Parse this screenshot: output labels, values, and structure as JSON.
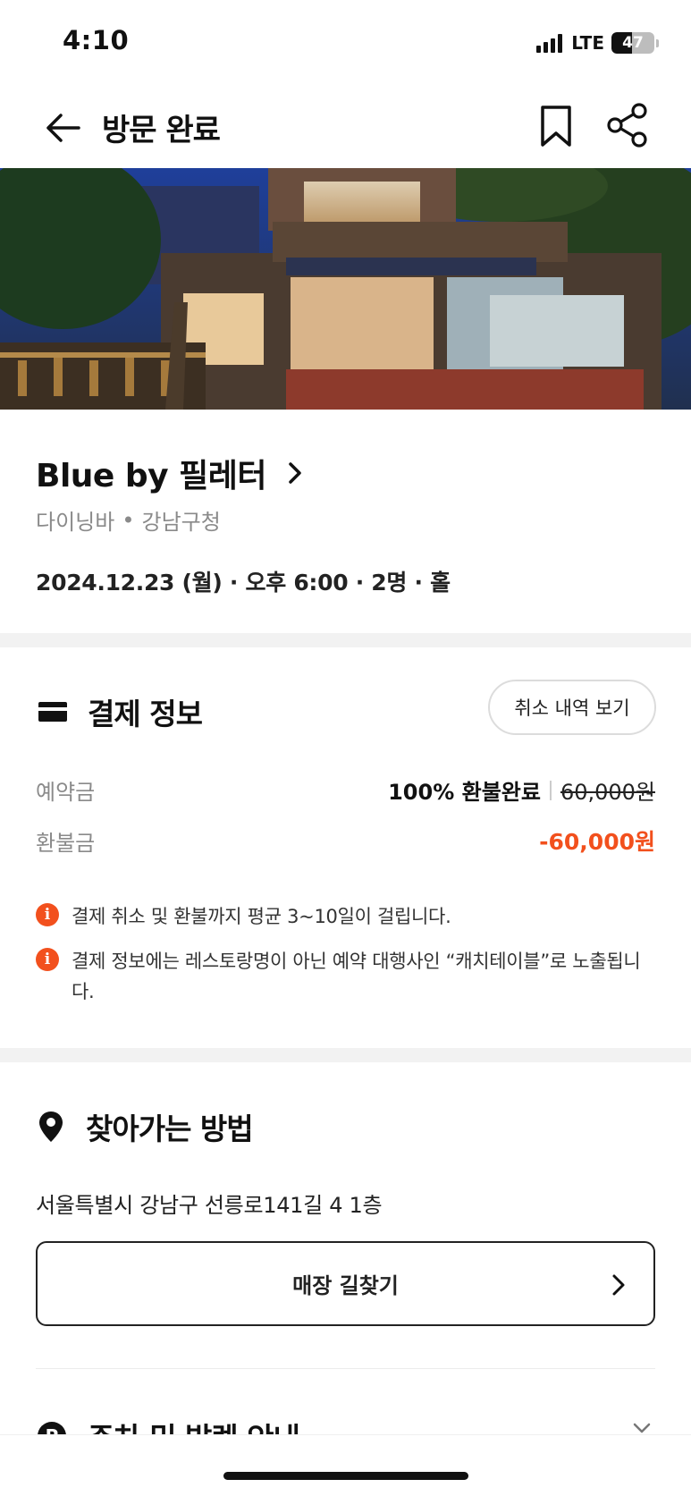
{
  "status_bar": {
    "time": "4:10",
    "network": "LTE",
    "battery": "47",
    "battery_level": 0.47
  },
  "header": {
    "title": "방문 완료",
    "back_icon": "arrow-left-icon",
    "bookmark_icon": "bookmark-icon",
    "share_icon": "share-icon"
  },
  "restaurant": {
    "name": "Blue by 필레터",
    "category": "다이닝바",
    "area": "강남구청",
    "booking": "2024.12.23 (월) · 오후 6:00 · 2명 · 홀"
  },
  "payment": {
    "title": "결제 정보",
    "cancel_history_label": "취소 내역 보기",
    "deposit_label": "예약금",
    "refund_status": "100% 환불완료",
    "original_price": "60,000원",
    "refund_label": "환불금",
    "refund_amount": "-60,000원",
    "notices": [
      "결제 취소 및 환불까지 평균 3~10일이 걸립니다.",
      "결제 정보에는 레스토랑명이 아닌 예약 대행사인 “캐치테이블”로 노출됩니다."
    ],
    "notice_icon_glyph": "i"
  },
  "directions": {
    "title": "찾아가는 방법",
    "address": "서울특별시 강남구 선릉로141길 4 1층",
    "route_button_label": "매장 길찾기"
  },
  "parking": {
    "title": "주차 및 발렛 안내",
    "icon_glyph": "P"
  },
  "colors": {
    "accent": "#f2501d",
    "text": "#111111",
    "muted": "#8a8a8a",
    "divider": "#f2f2f2"
  }
}
